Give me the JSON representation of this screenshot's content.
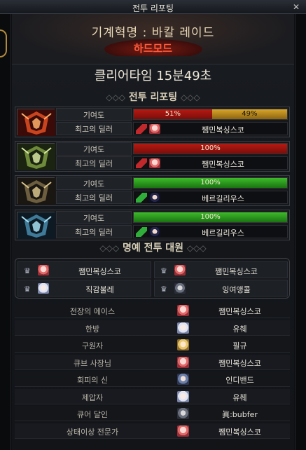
{
  "window": {
    "title": "전투 리포팅"
  },
  "header": {
    "raid_name": "기계혁명 : 바칼 레이드",
    "mode": "하드모드"
  },
  "clear_time": "클리어타임  15분49초",
  "report_section": {
    "title": "전투 리포팅",
    "ornament_left": "◇◇◇",
    "ornament_right": "◇◇◇"
  },
  "bosses": [
    {
      "contribution_label": "기여도",
      "best_dealer_label": "최고의 딜러",
      "contribution": [
        {
          "pct_text": "51%",
          "value": 51,
          "color": "#b51b12"
        },
        {
          "pct_text": "49%",
          "value": 49,
          "color": "#d8a62a"
        }
      ],
      "dealer": "쨈민복싱스코",
      "class_color": "#c0282c",
      "face": "pink",
      "portrait_theme": "red"
    },
    {
      "contribution_label": "기여도",
      "best_dealer_label": "최고의 딜러",
      "contribution": [
        {
          "pct_text": "100%",
          "value": 100,
          "color": "#b51b12"
        }
      ],
      "dealer": "쨈민복싱스코",
      "class_color": "#c0282c",
      "face": "pink",
      "portrait_theme": "green"
    },
    {
      "contribution_label": "기여도",
      "best_dealer_label": "최고의 딜러",
      "contribution": [
        {
          "pct_text": "100%",
          "value": 100,
          "color": "#3dbb2a"
        }
      ],
      "dealer": "베르길리우스",
      "class_color": "#2fae3a",
      "face": "dark",
      "portrait_theme": "gold"
    },
    {
      "contribution_label": "기여도",
      "best_dealer_label": "최고의 딜러",
      "contribution": [
        {
          "pct_text": "100%",
          "value": 100,
          "color": "#3dbb2a"
        }
      ],
      "dealer": "베르길리우스",
      "class_color": "#2fae3a",
      "face": "dark",
      "portrait_theme": "blue"
    }
  ],
  "honor_section": {
    "title": "명예 전투 대원",
    "ornament_left": "◇◇◇",
    "ornament_right": "◇◇◇"
  },
  "honor_members": [
    {
      "name": "쨈민복싱스코",
      "face": "pink"
    },
    {
      "name": "쨈민복싱스코",
      "face": "pink"
    },
    {
      "name": "직감불레",
      "face": "white"
    },
    {
      "name": "잉여앵콜",
      "face": "grey"
    }
  ],
  "awards": [
    {
      "title": "전장의 에이스",
      "name": "쨈민복싱스코",
      "face": "pink"
    },
    {
      "title": "한방",
      "name": "유췌",
      "face": "white"
    },
    {
      "title": "구원자",
      "name": "필규",
      "face": "blond"
    },
    {
      "title": "큐브 사장님",
      "name": "쨈민복싱스코",
      "face": "pink"
    },
    {
      "title": "회피의 신",
      "name": "인디밴드",
      "face": "blue"
    },
    {
      "title": "제압자",
      "name": "유췌",
      "face": "white"
    },
    {
      "title": "큐어 달인",
      "name": "眞:bubfer",
      "face": "grey"
    },
    {
      "title": "상태이상 전문가",
      "name": "쨈민복싱스코",
      "face": "pink"
    }
  ]
}
